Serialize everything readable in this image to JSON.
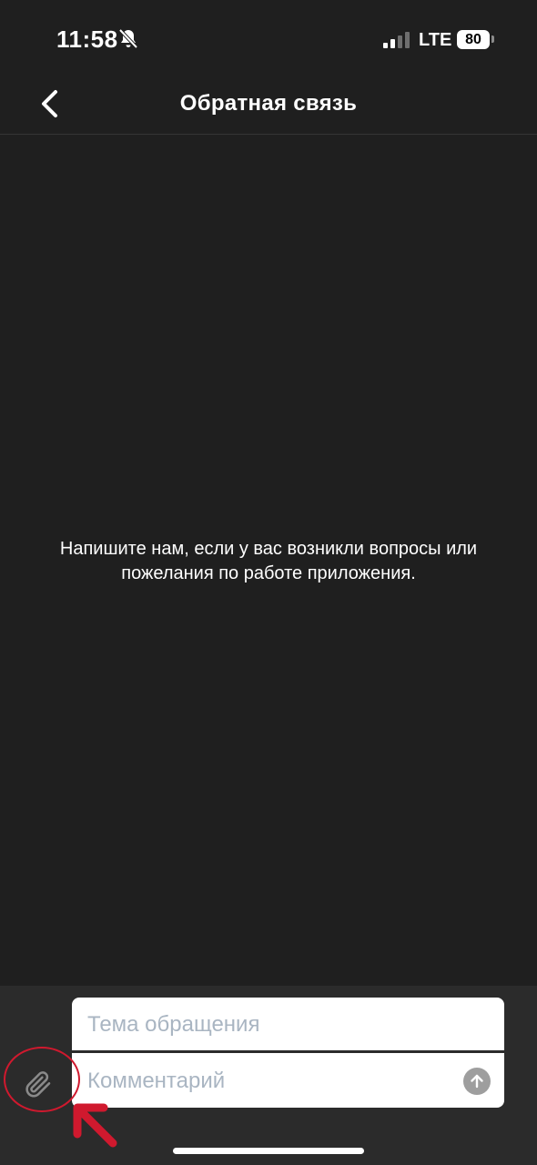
{
  "status_bar": {
    "time": "11:58",
    "network": "LTE",
    "battery": "80",
    "icons": [
      "bell-slash-icon",
      "signal-icon"
    ]
  },
  "nav": {
    "title": "Обратная связь",
    "back_icon": "chevron-left-icon"
  },
  "main": {
    "empty_message": "Напишите нам, если у вас возникли вопросы или пожелания по работе приложения."
  },
  "composer": {
    "subject_placeholder": "Тема обращения",
    "comment_placeholder": "Комментарий",
    "attach_icon": "paperclip-icon",
    "send_icon": "arrow-up-icon"
  },
  "colors": {
    "background": "#1f1f1f",
    "composer_background": "#2b2b2b",
    "input_background": "#ffffff",
    "placeholder": "#a9b5c2",
    "annotation": "#d0192e"
  }
}
